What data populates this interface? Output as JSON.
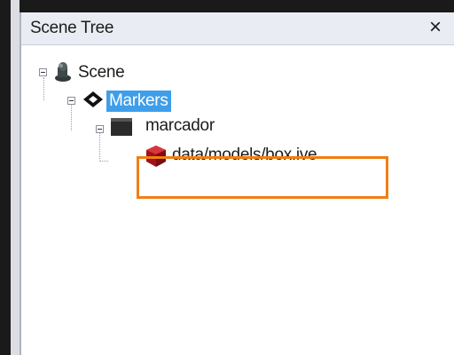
{
  "window": {
    "title": "Scene Tree",
    "close_glyph": "×"
  },
  "tree": {
    "nodes": [
      {
        "label": "Scene",
        "icon": "scene-icon",
        "expanded": true,
        "selected": false
      },
      {
        "label": "Markers",
        "icon": "marker-icon",
        "expanded": true,
        "selected": true
      },
      {
        "label": "marcador",
        "icon": "marker-object-icon",
        "expanded": true,
        "selected": false
      },
      {
        "label": "data/models/box.ive",
        "icon": "model-box-icon",
        "expanded": false,
        "selected": false
      }
    ]
  },
  "colors": {
    "selection": "#3f9ee9",
    "highlight_box": "#f07f14",
    "model_icon": "#c41a1a"
  }
}
